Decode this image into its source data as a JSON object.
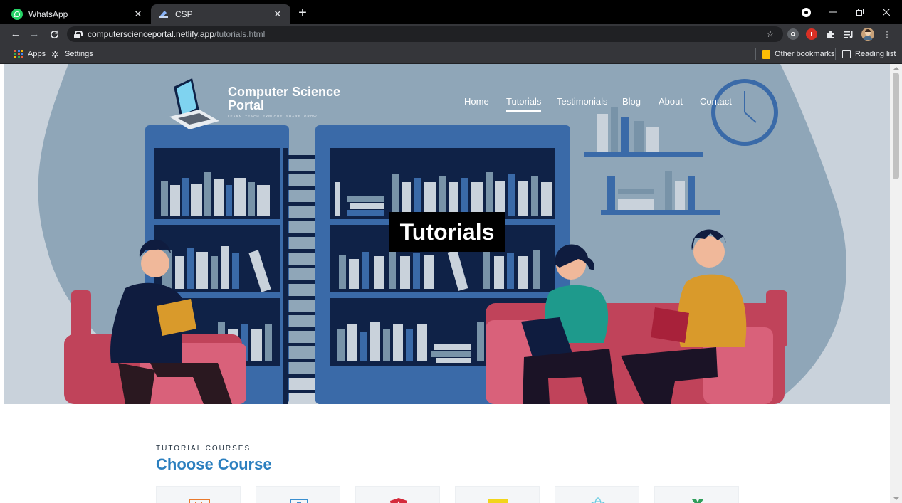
{
  "browser": {
    "tabs": [
      {
        "title": "WhatsApp",
        "favicon": "whatsapp-icon",
        "color": "#25d366",
        "active": false
      },
      {
        "title": "CSP",
        "favicon": "csp-icon",
        "color": "#8ab4f8",
        "active": true
      }
    ],
    "new_tab_label": "+",
    "close_label": "✕",
    "url_host": "computerscienceportal.netlify.app",
    "url_path": "/tutorials.html",
    "bookmarks": {
      "apps_label": "Apps",
      "settings_label": "Settings",
      "other_bookmarks_label": "Other bookmarks",
      "reading_list_label": "Reading list"
    }
  },
  "site": {
    "brand_name": "Computer Science Portal",
    "brand_tagline": "LEARN. TEACH. EXPLORE. SHARE. GROW.",
    "nav": [
      {
        "label": "Home",
        "current": false
      },
      {
        "label": "Tutorials",
        "current": true
      },
      {
        "label": "Testimonials",
        "current": false
      },
      {
        "label": "Blog",
        "current": false
      },
      {
        "label": "About",
        "current": false
      },
      {
        "label": "Contact",
        "current": false
      }
    ],
    "hero_title": "Tutorials",
    "section_kicker": "TUTORIAL COURSES",
    "section_title": "Choose Course",
    "accent_color": "#2b7fbf"
  }
}
